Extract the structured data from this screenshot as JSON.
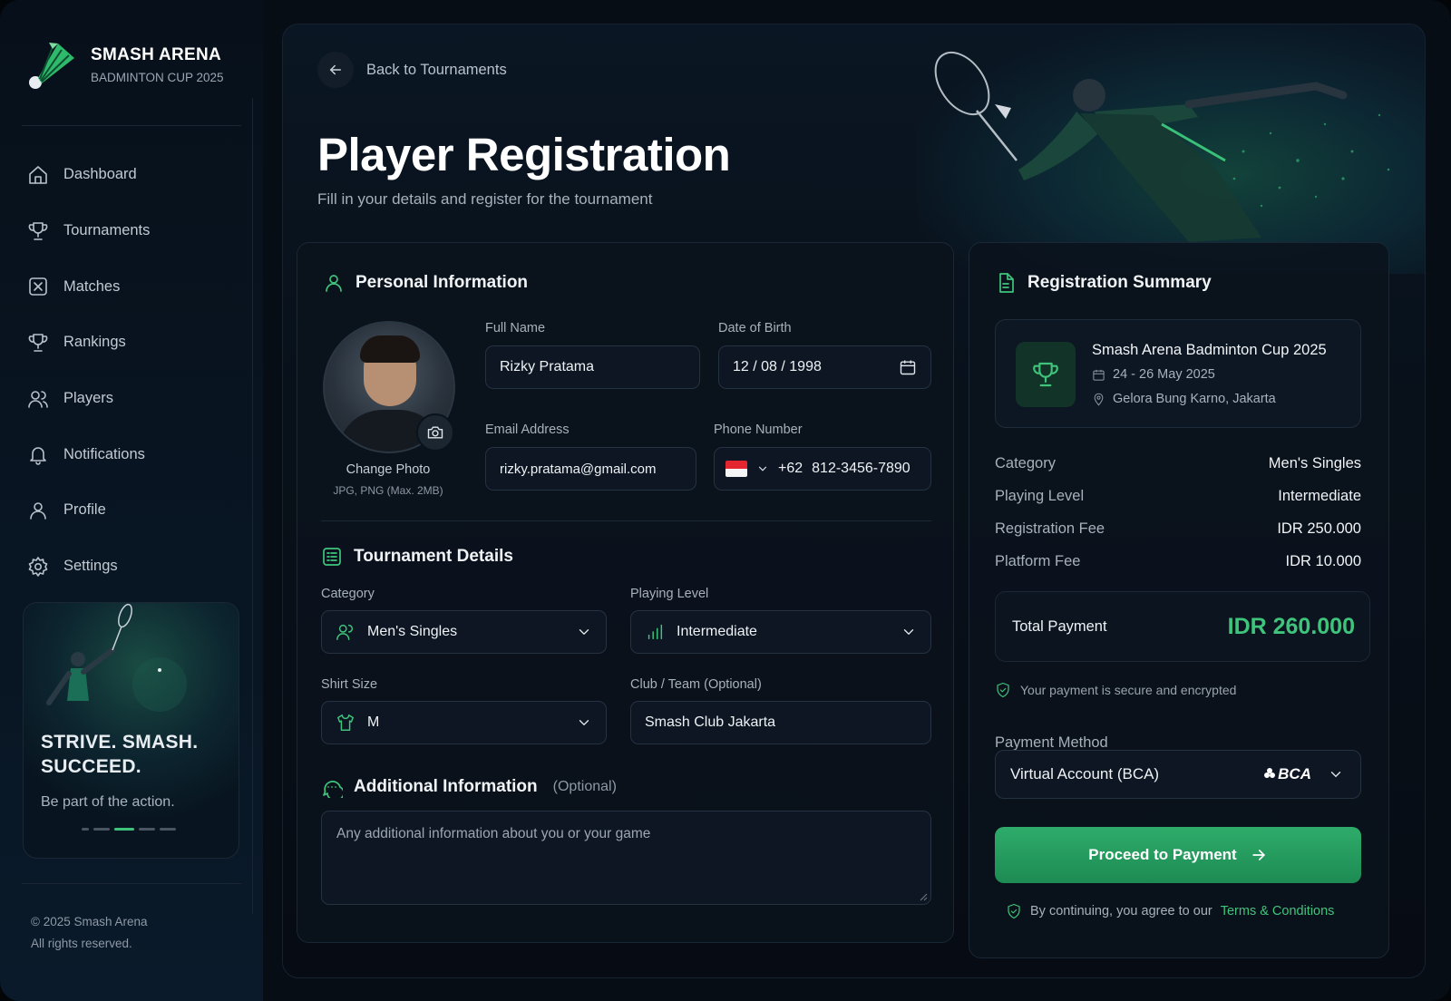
{
  "brand": {
    "title": "SMASH ARENA",
    "subtitle": "BADMINTON CUP 2025"
  },
  "nav": [
    {
      "label": "Dashboard",
      "icon": "home-icon"
    },
    {
      "label": "Tournaments",
      "icon": "trophy-icon"
    },
    {
      "label": "Matches",
      "icon": "matches-icon"
    },
    {
      "label": "Rankings",
      "icon": "trophy-icon"
    },
    {
      "label": "Players",
      "icon": "users-icon"
    },
    {
      "label": "Notifications",
      "icon": "bell-icon"
    },
    {
      "label": "Profile",
      "icon": "user-icon"
    },
    {
      "label": "Settings",
      "icon": "gear-icon"
    }
  ],
  "promo": {
    "headline_line1": "STRIVE. SMASH.",
    "headline_line2": "SUCCEED.",
    "subtitle": "Be part of the action.",
    "slides": 5,
    "active_slide": 3
  },
  "footer": {
    "line1": "© 2025 Smash Arena",
    "line2": "All rights reserved."
  },
  "header": {
    "back_label": "Back to Tournaments",
    "title": "Player Registration",
    "subtitle": "Fill in your details and register for the tournament"
  },
  "personal": {
    "title": "Personal Information",
    "change_photo": "Change Photo",
    "photo_hint": "JPG, PNG (Max. 2MB)",
    "full_name_label": "Full Name",
    "full_name": "Rizky Pratama",
    "dob_label": "Date of Birth",
    "dob": "12 / 08 / 1998",
    "email_label": "Email Address",
    "email": "rizky.pratama@gmail.com",
    "phone_label": "Phone Number",
    "phone_code": "+62",
    "phone": "812-3456-7890"
  },
  "tournament": {
    "title": "Tournament Details",
    "category_label": "Category",
    "category": "Men's Singles",
    "level_label": "Playing Level",
    "level": "Intermediate",
    "shirt_label": "Shirt Size",
    "shirt": "M",
    "club_label": "Club / Team (Optional)",
    "club": "Smash Club Jakarta"
  },
  "additional": {
    "title": "Additional Information",
    "optional": "(Optional)",
    "placeholder": "Any additional information about you or your game"
  },
  "summary": {
    "title": "Registration Summary",
    "event_name": "Smash Arena Badminton Cup 2025",
    "event_dates": "24 - 26 May 2025",
    "event_venue": "Gelora Bung Karno, Jakarta",
    "rows": [
      {
        "k": "Category",
        "v": "Men's Singles"
      },
      {
        "k": "Playing Level",
        "v": "Intermediate"
      },
      {
        "k": "Registration Fee",
        "v": "IDR 250.000"
      },
      {
        "k": "Platform Fee",
        "v": "IDR 10.000"
      }
    ],
    "total_label": "Total Payment",
    "total_value": "IDR 260.000",
    "secure_text": "Your payment is secure and encrypted",
    "payment_label": "Payment Method",
    "payment_value": "Virtual Account (BCA)",
    "bank_logo": "BCA",
    "cta": "Proceed to Payment",
    "terms_prefix": "By continuing, you agree to our",
    "terms_link": "Terms & Conditions"
  },
  "colors": {
    "accent": "#3fc47c",
    "background": "#070d15",
    "card": "#0a121c"
  }
}
